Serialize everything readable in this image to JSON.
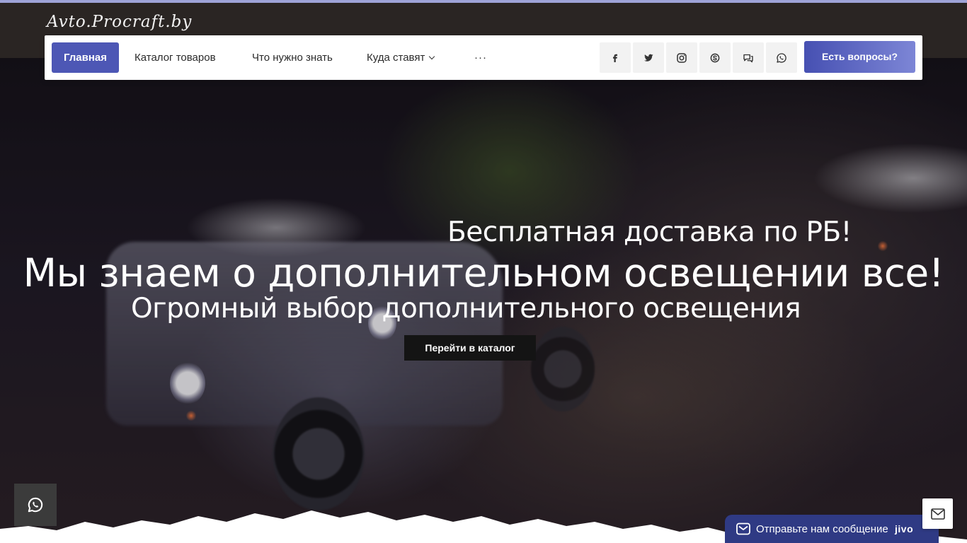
{
  "site": {
    "logo_text": "Avto.Procraft.by"
  },
  "nav": {
    "items": [
      {
        "label": "Главная",
        "active": true
      },
      {
        "label": "Каталог товаров"
      },
      {
        "label": "Что нужно знать"
      },
      {
        "label": "Куда ставят",
        "has_dropdown": true
      },
      {
        "label": "···"
      }
    ],
    "social": [
      "facebook-icon",
      "twitter-icon",
      "instagram-icon",
      "skype-icon",
      "chat-icon",
      "whatsapp-icon"
    ],
    "cta_label": "Есть вопросы?"
  },
  "hero": {
    "line1": "Бесплатная доставка по РБ!",
    "headline": "Мы знаем о дополнительном освещении все!",
    "line3": "Огромный выбор дополнительного освещения",
    "button_label": "Перейти в каталог"
  },
  "widgets": {
    "whatsapp_icon": "whatsapp-icon",
    "jivo_text": "Отправьте нам сообщение",
    "jivo_brand": "jivo",
    "mail_icon": "mail-icon"
  },
  "colors": {
    "accent": "#4d57b5",
    "topbar": "#2a2523",
    "jivo": "#2f3a84"
  }
}
